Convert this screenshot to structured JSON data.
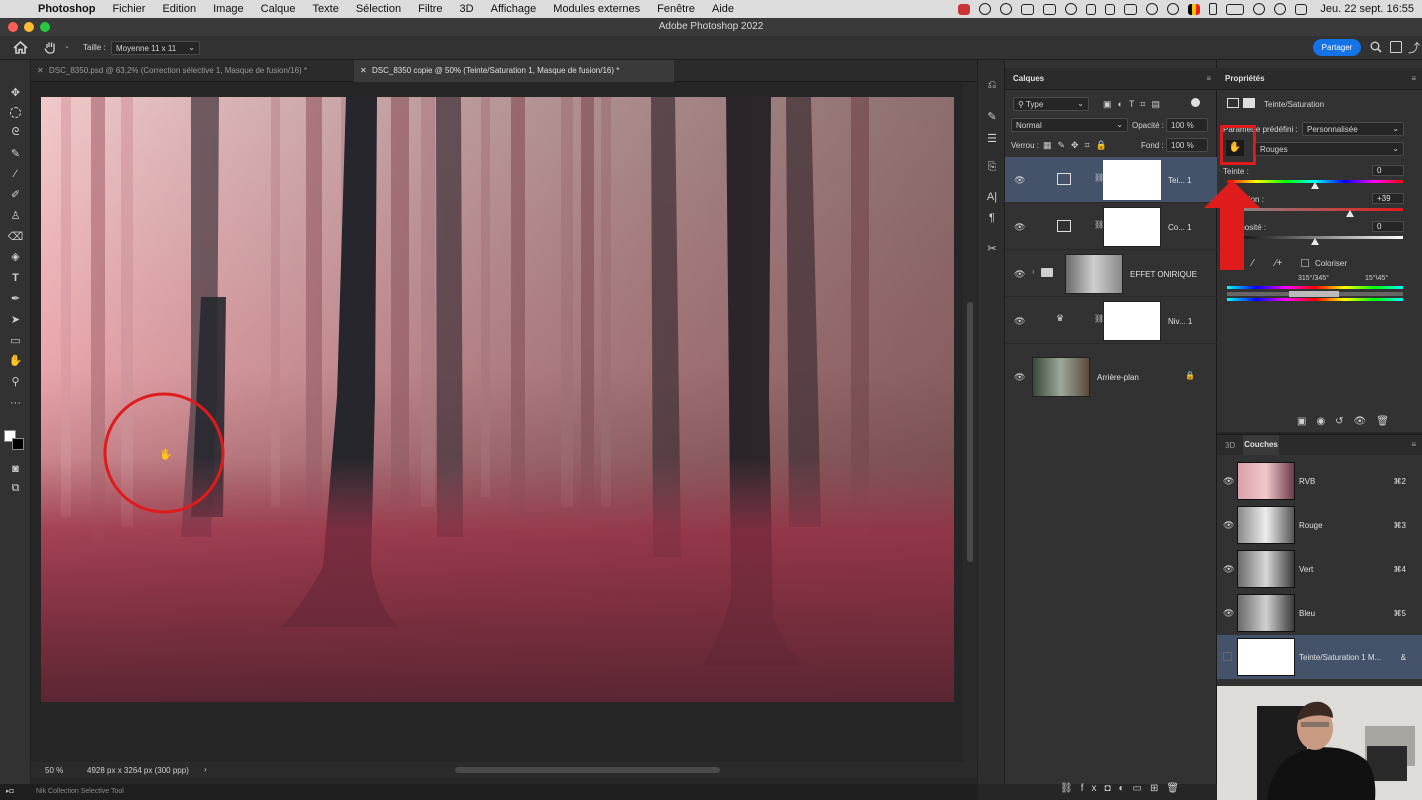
{
  "menubar": {
    "items": [
      "Photoshop",
      "Fichier",
      "Edition",
      "Image",
      "Calque",
      "Texte",
      "Sélection",
      "Filtre",
      "3D",
      "Affichage",
      "Modules externes",
      "Fenêtre",
      "Aide"
    ],
    "clock": "Jeu. 22 sept.  16:55"
  },
  "window": {
    "title": "Adobe Photoshop 2022"
  },
  "options": {
    "size_label": "Taille :",
    "size_value": "Moyenne 11 x 11",
    "share_label": "Partager"
  },
  "tabs": [
    {
      "label": "DSC_8350.psd @ 63,2% (Correction sélective 1, Masque de fusion/16) *",
      "active": false
    },
    {
      "label": "DSC_8350 copie @ 50% (Teinte/Saturation 1, Masque de fusion/16) *",
      "active": true
    }
  ],
  "status": {
    "zoom": "50 %",
    "doc_info": "4928 px x 3264 px (300 ppp)",
    "arrow": "›"
  },
  "bottombar": {
    "plugin": "Nik Collection Selective Tool"
  },
  "layers_panel": {
    "title": "Calques",
    "filter": "Type",
    "blend_mode": "Normal",
    "opacity_label": "Opacité :",
    "opacity_value": "100 %",
    "lock_label": "Verrou :",
    "fill_label": "Fond :",
    "fill_value": "100 %",
    "layers": [
      {
        "name": "Tei... 1",
        "selected": true
      },
      {
        "name": "Co... 1",
        "selected": false
      },
      {
        "name": "EFFET ONIRIQUE",
        "selected": false
      },
      {
        "name": "Niv... 1",
        "selected": false
      },
      {
        "name": "Arrière-plan",
        "selected": false
      }
    ]
  },
  "properties_panel": {
    "title": "Propriétés",
    "adjustment": "Teinte/Saturation",
    "preset_label": "Paramètre prédéfini :",
    "preset_value": "Personnalisée",
    "channel_value": "Rouges",
    "hue_label": "Teinte :",
    "hue_value": "0",
    "sat_label": "Saturation :",
    "sat_value": "+39",
    "light_label": "Luminosité :",
    "light_value": "0",
    "colorize_label": "Coloriser",
    "range_left": "315°/345°",
    "range_right": "15°\\45°",
    "hue_level": 0.5,
    "sat_level": 0.7,
    "light_level": 0.5
  },
  "channels_panel": {
    "tab_3d": "3D",
    "title": "Couches",
    "channels": [
      {
        "name": "RVB",
        "shortcut": "⌘2"
      },
      {
        "name": "Rouge",
        "shortcut": "⌘3"
      },
      {
        "name": "Vert",
        "shortcut": "⌘4"
      },
      {
        "name": "Bleu",
        "shortcut": "⌘5"
      },
      {
        "name": "Teinte/Saturation 1 M...",
        "shortcut": "&"
      }
    ]
  },
  "colors": {
    "accent": "#1473e6",
    "selected_layer": "#44536a",
    "highlight_red": "#e01b1b"
  }
}
